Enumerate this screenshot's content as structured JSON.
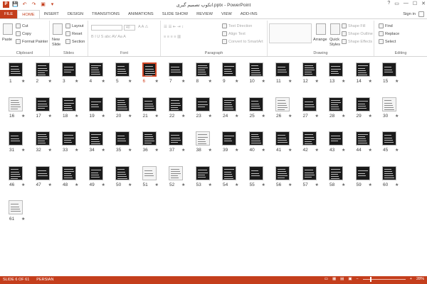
{
  "window": {
    "title": "اتکوپ تصمیم گیری.pptx - PowerPoint",
    "controls": [
      "?",
      "▭",
      "—",
      "☐",
      "✕"
    ]
  },
  "qat": {
    "app": "P",
    "save": "💾",
    "undo": "↶",
    "redo": "↷",
    "start": "▣",
    "more": "▾"
  },
  "tabs": [
    "FILE",
    "HOME",
    "INSERT",
    "DESIGN",
    "TRANSITIONS",
    "ANIMATIONS",
    "SLIDE SHOW",
    "REVIEW",
    "VIEW",
    "ADD-INS"
  ],
  "active_tab": "HOME",
  "signin": "Sign in",
  "ribbon": {
    "clipboard": {
      "name": "Clipboard",
      "paste": "Paste",
      "cut": "Cut",
      "copy": "Copy",
      "format_painter": "Format Painter"
    },
    "slides": {
      "name": "Slides",
      "new_slide": "New",
      "new_slide2": "Slide",
      "layout": "Layout",
      "reset": "Reset",
      "section": "Section"
    },
    "font": {
      "name": "Font",
      "size": "40"
    },
    "paragraph": {
      "name": "Paragraph",
      "text_direction": "Text Direction",
      "align_text": "Align Text",
      "convert": "Convert to SmartArt"
    },
    "drawing": {
      "name": "Drawing",
      "arrange": "Arrange",
      "quick_styles": "Quick",
      "quick_styles2": "Styles",
      "fill": "Shape Fill",
      "outline": "Shape Outline",
      "effects": "Shape Effects"
    },
    "editing": {
      "name": "Editing",
      "find": "Find",
      "replace": "Replace",
      "select": "Select"
    }
  },
  "slides": {
    "count": 61,
    "selected": 6,
    "light_slides": [
      16,
      26,
      30,
      38,
      51,
      52,
      61
    ]
  },
  "status": {
    "slide": "SLIDE 6 OF 61",
    "language": "PERSIAN",
    "zoom": "28%"
  }
}
